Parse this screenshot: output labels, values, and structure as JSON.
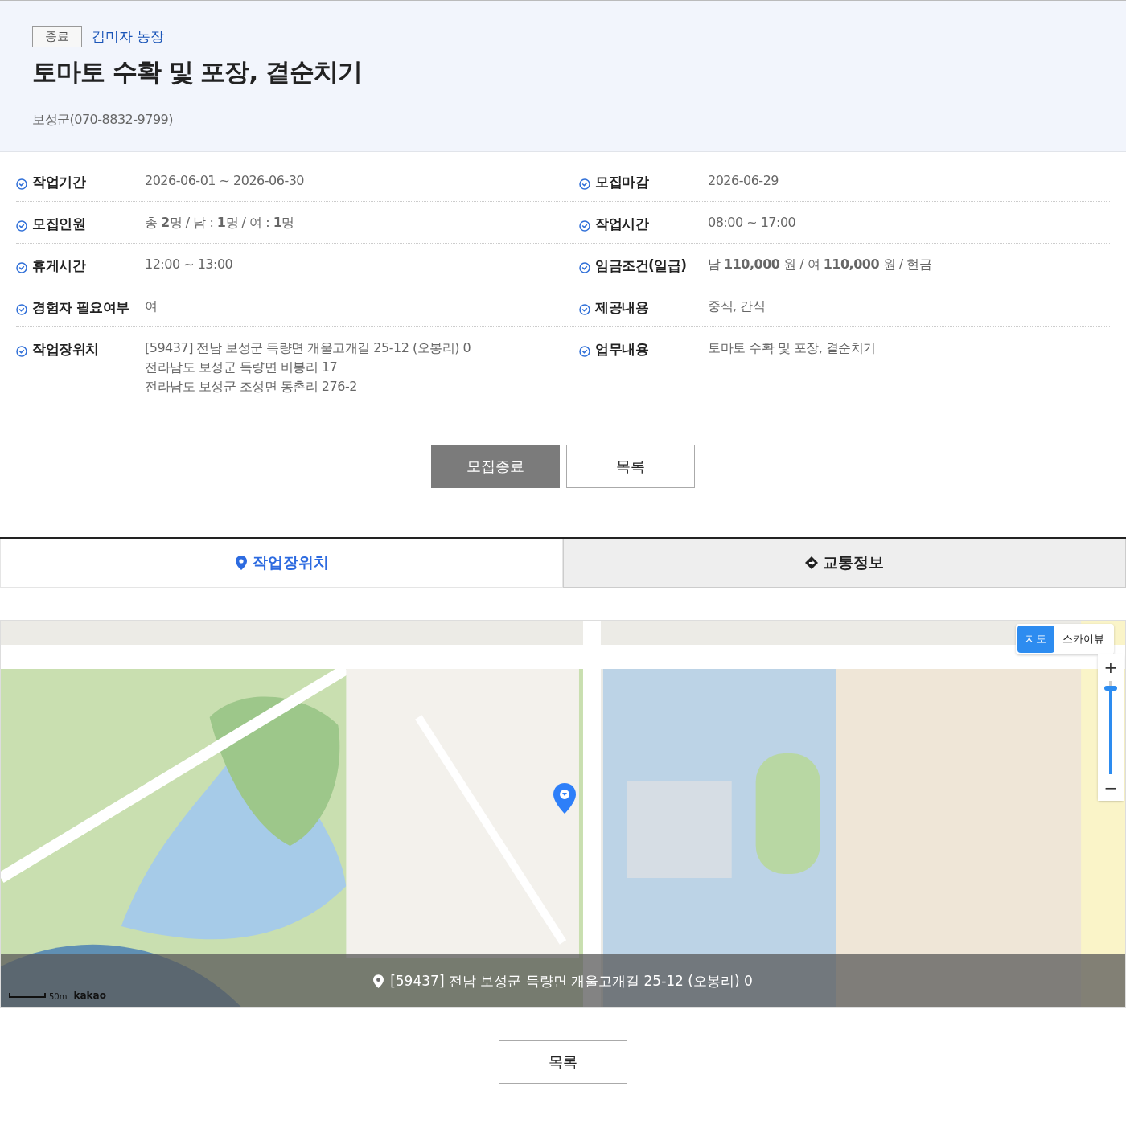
{
  "header": {
    "status_badge": "종료",
    "farm_name": "김미자 농장",
    "title": "토마토 수확 및 포장, 곁순치기",
    "contact": "보성군(070-8832-9799)"
  },
  "details": [
    {
      "label": "작업기간",
      "lines": [
        "2026-06-01 ~ 2026-06-30"
      ]
    },
    {
      "label": "모집마감",
      "lines": [
        "2026-06-29"
      ]
    },
    {
      "label": "모집인원",
      "lines": [
        "총 **2**명 / 남 : **1**명 / 여 : **1**명"
      ]
    },
    {
      "label": "작업시간",
      "lines": [
        "08:00 ~ 17:00"
      ]
    },
    {
      "label": "휴게시간",
      "lines": [
        "12:00 ~ 13:00"
      ]
    },
    {
      "label": "임금조건(일급)",
      "lines": [
        "남 **110,000** 원 / 여 **110,000** 원 / 현금"
      ]
    },
    {
      "label": "경험자 필요여부",
      "lines": [
        "여"
      ]
    },
    {
      "label": "제공내용",
      "lines": [
        "중식, 간식"
      ]
    },
    {
      "label": "작업장위치",
      "lines": [
        "[59437] 전남 보성군 득량면 개울고개길 25-12 (오봉리) 0",
        "전라남도 보성군 득량면 비봉리 17",
        "전라남도 보성군 조성면 동촌리 276-2"
      ]
    },
    {
      "label": "업무내용",
      "lines": [
        "토마토 수확 및 포장, 곁순치기"
      ]
    }
  ],
  "actions": [
    {
      "label": "모집종료",
      "disabled": true
    },
    {
      "label": "목록",
      "disabled": false
    }
  ],
  "tabs": [
    {
      "label": "작업장위치",
      "kind": "pin",
      "selected": true
    },
    {
      "label": "교통정보",
      "kind": "route",
      "selected": false
    }
  ],
  "map": {
    "kind": "picture",
    "map_types": [
      {
        "label": "지도",
        "selected": true
      },
      {
        "label": "스카이뷰",
        "selected": false
      }
    ],
    "zoom": {
      "in": "+",
      "out": "−",
      "level": 0.95
    },
    "scale": {
      "distance": "50m",
      "provider": "kakao"
    },
    "address": "[59437] 전남 보성군 득량면 개울고개길 25-12 (오봉리) 0"
  },
  "bottom_button": "목록"
}
